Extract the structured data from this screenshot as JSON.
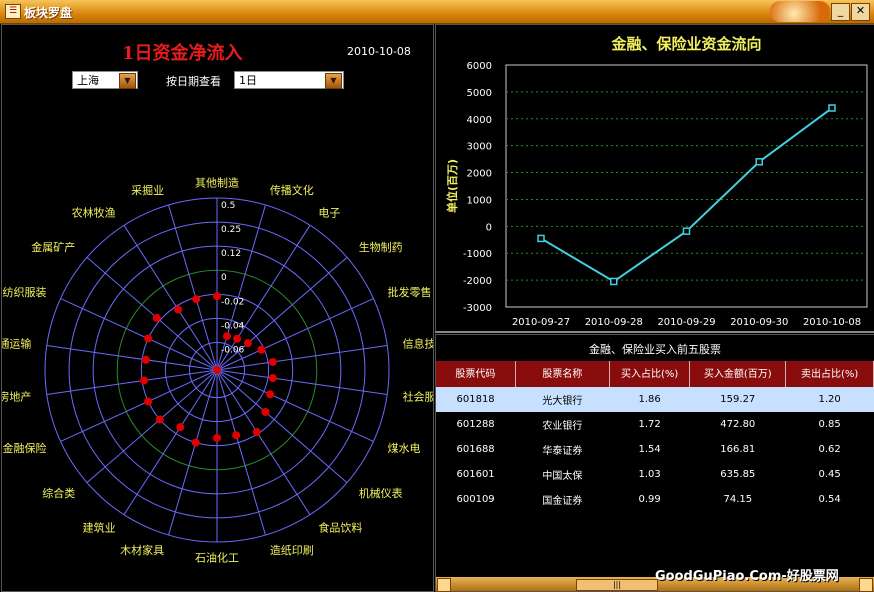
{
  "window": {
    "title": "板块罗盘"
  },
  "left": {
    "title": "1日资金净流入",
    "date": "2010-10-08",
    "market_select": "上海",
    "period_label": "按日期查看",
    "period_select": "1日"
  },
  "radar_chart": {
    "type": "radar",
    "sectors": [
      "其他制造",
      "传播文化",
      "电子",
      "生物制药",
      "批发零售",
      "信息技术",
      "社会服务",
      "煤水电",
      "机械仪表",
      "食品饮料",
      "造纸印刷",
      "石油化工",
      "木材家具",
      "建筑业",
      "综合类",
      "金融保险",
      "房地产",
      "通运输",
      "纺织服装",
      "金属矿产",
      "农林牧渔",
      "采掘业"
    ],
    "values": [
      0.24,
      0.04,
      0.05,
      0.07,
      0.11,
      0.15,
      0.15,
      0.16,
      0.19,
      0.24,
      0.21,
      0.21,
      0.25,
      0.21,
      0.25,
      0.25,
      0.24,
      0.23,
      0.25,
      0.27,
      0.23,
      0.24
    ],
    "rings": [
      "0.5",
      "0.25",
      "0.12",
      "0",
      "-0.02",
      "-0.04",
      "-0.06"
    ]
  },
  "line_chart": {
    "type": "line",
    "title": "金融、保险业资金流向",
    "ylabel": "单位(百万)",
    "x": [
      "2010-09-27",
      "2010-09-28",
      "2010-09-29",
      "2010-09-30",
      "2010-10-08"
    ],
    "values": [
      -450,
      -2050,
      -180,
      2400,
      4400
    ],
    "ylim": [
      -3000,
      6000
    ],
    "yticks": [
      "6000",
      "5000",
      "4000",
      "3000",
      "2000",
      "1000",
      "0",
      "-1000",
      "-2000",
      "-3000"
    ],
    "line_color": "#40d0e0"
  },
  "table": {
    "title": "金融、保险业买入前五股票",
    "headers": [
      "股票代码",
      "股票名称",
      "买入占比(%)",
      "买入金额(百万)",
      "卖出占比(%)"
    ],
    "rows": [
      [
        "601818",
        "光大银行",
        "1.86",
        "159.27",
        "1.20"
      ],
      [
        "601288",
        "农业银行",
        "1.72",
        "472.80",
        "0.85"
      ],
      [
        "601688",
        "华泰证券",
        "1.54",
        "166.81",
        "0.62"
      ],
      [
        "601601",
        "中国太保",
        "1.03",
        "635.85",
        "0.45"
      ],
      [
        "600109",
        "国金证券",
        "0.99",
        "74.15",
        "0.54"
      ]
    ]
  },
  "scrollbar": {
    "thumb_label": "|||"
  },
  "watermark": "GoodGuPiao.Com-好股票网",
  "colors": {
    "title_red": "#e81c1c",
    "marker_red": "#e00000",
    "grid_blue": "#6a6aff",
    "yellow": "#f0f060"
  }
}
